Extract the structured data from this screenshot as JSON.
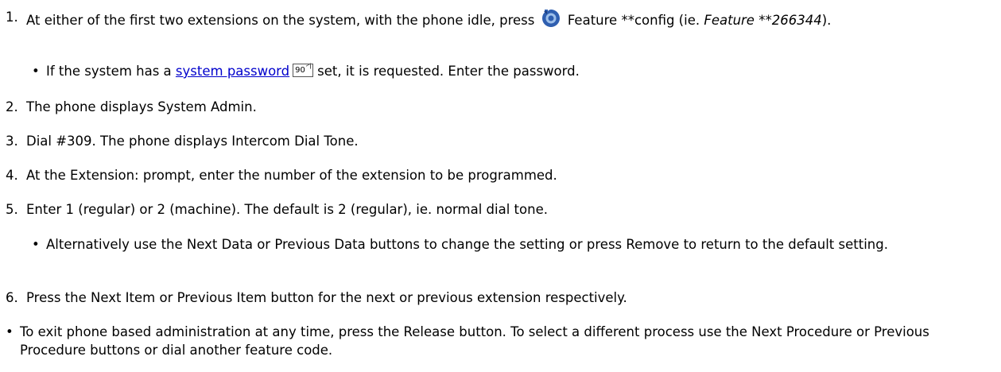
{
  "steps": [
    {
      "number": "1.",
      "prefix": "At either of the first two extensions on the system, with the phone idle, press",
      "icon": "feature-key-icon",
      "after_icon": "Feature **config (ie.",
      "italic_code": "Feature **266344",
      "suffix": ").",
      "bullet": {
        "prefix": "If the system has a",
        "link_text": "system password",
        "page_ref": "90",
        "suffix": "set, it is requested. Enter the password."
      }
    },
    {
      "number": "2.",
      "text": "The phone displays System Admin."
    },
    {
      "number": "3.",
      "text": "Dial #309. The phone displays Intercom Dial Tone."
    },
    {
      "number": "4.",
      "text": "At the Extension: prompt, enter the number of the extension to be programmed."
    },
    {
      "number": "5.",
      "text": "Enter 1 (regular) or 2 (machine). The default is 2 (regular), ie. normal dial tone.",
      "bullet": "Alternatively use the Next Data or Previous Data buttons to change the setting or press Remove to return to the default setting."
    },
    {
      "number": "6.",
      "text": "Press the Next Item or Previous Item button for the next or previous extension respectively."
    }
  ],
  "final_bullet": "To exit phone based administration at any time, press the Release button. To select a different process use the Next Procedure or Previous Procedure buttons or dial another feature code.",
  "colors": {
    "link": "#0000cc",
    "icon_blue": "#2f5fb0"
  }
}
